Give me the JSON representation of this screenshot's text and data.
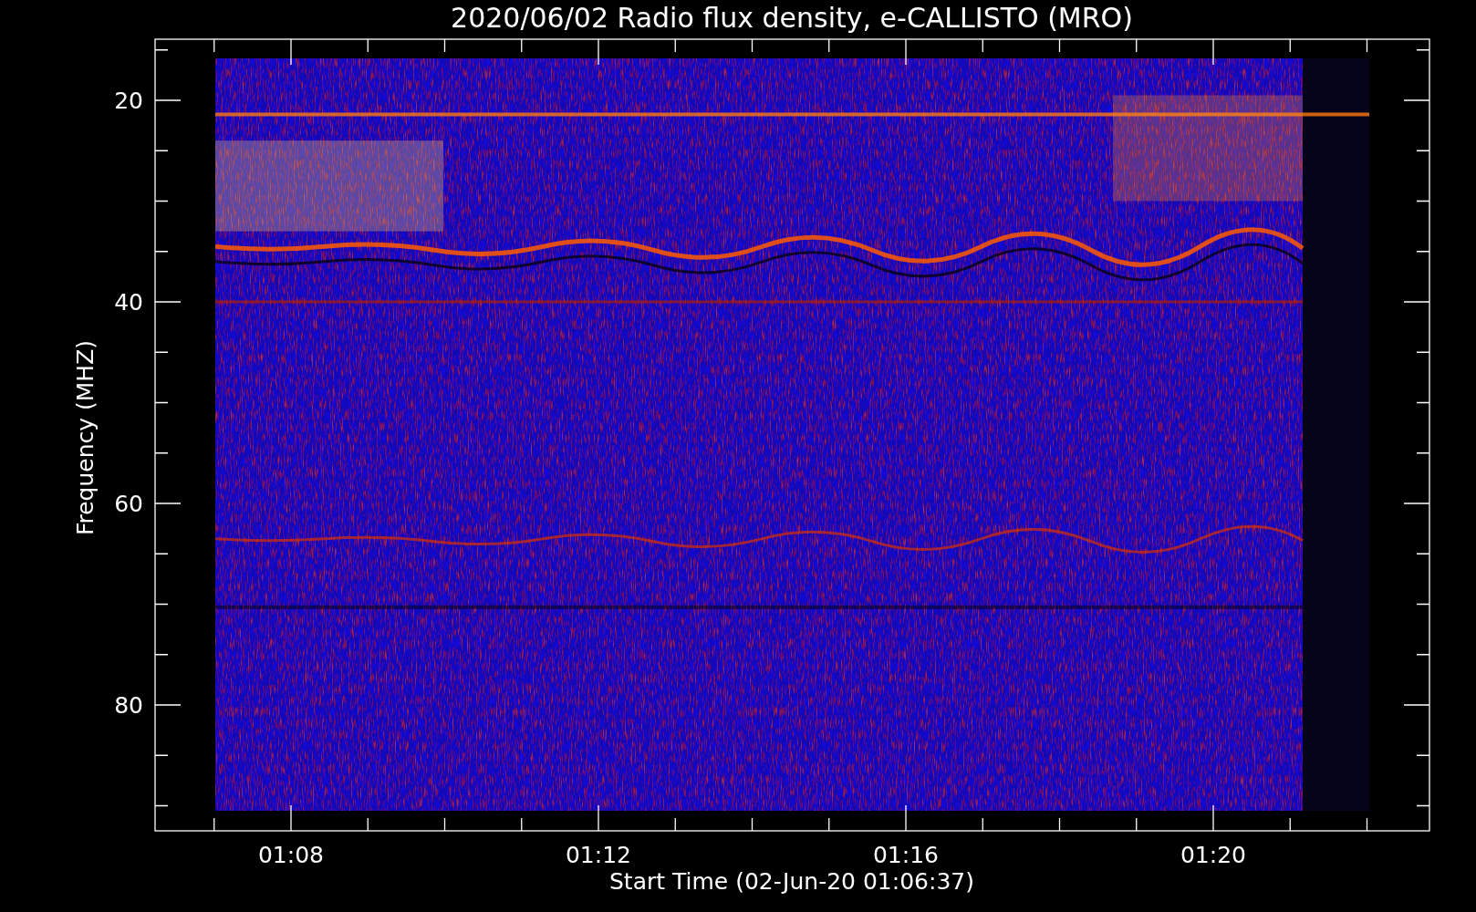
{
  "title": "2020/06/02  Radio flux density, e-CALLISTO (MRO)",
  "xlabel": "Start Time (02-Jun-20 01:06:37)",
  "ylabel": "Frequency (MHZ)",
  "xticks": [
    "01:08",
    "01:12",
    "01:16",
    "01:20"
  ],
  "yticks": [
    "20",
    "40",
    "60",
    "80"
  ]
}
